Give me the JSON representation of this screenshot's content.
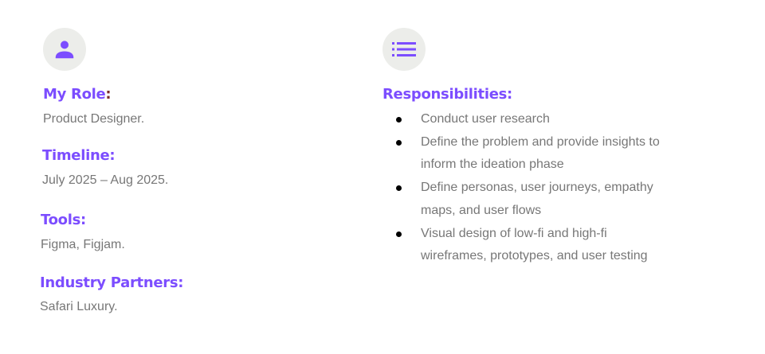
{
  "left": {
    "role": {
      "heading": "My Role",
      "colon": ":",
      "value": "Product Designer."
    },
    "timeline": {
      "heading": "Timeline:",
      "value": "July 2025 – Aug 2025."
    },
    "tools": {
      "heading": "Tools:",
      "value": "Figma, Figjam."
    },
    "partners": {
      "heading": "Industry Partners:",
      "value": "Safari Luxury."
    }
  },
  "right": {
    "heading": "Responsibilities:",
    "items": [
      "Conduct user research",
      "Define the problem and provide insights to inform the ideation phase",
      "Define personas, user journeys, empathy maps, and user flows",
      "Visual design of low-fi and high-fi wireframes, prototypes, and user testing"
    ]
  },
  "colors": {
    "accent": "#7c4dff",
    "icon_bg": "#ecedea",
    "text": "#777777"
  }
}
